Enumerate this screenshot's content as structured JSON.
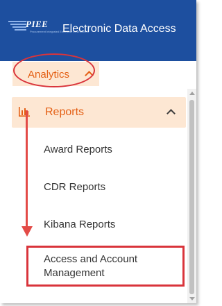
{
  "header": {
    "logo_text": "PIEE",
    "logo_subtext": "Procurement Integrated Enterprise Environment",
    "title": "Electronic Data Access",
    "background_color": "#1d4f9f"
  },
  "nav": {
    "analytics_label": "Analytics",
    "analytics_icon": "chevron-up-icon"
  },
  "menu": {
    "reports_label": "Reports",
    "reports_icon": "bar-chart-icon",
    "reports_chevron": "chevron-up-icon",
    "items": [
      {
        "label": "Award Reports"
      },
      {
        "label": "CDR Reports"
      },
      {
        "label": "Kibana Reports"
      },
      {
        "label": "Access and Account Management"
      }
    ]
  },
  "colors": {
    "accent": "#e45f14",
    "highlight_bg": "#fde7d3",
    "annotation_red": "#d9343b"
  }
}
